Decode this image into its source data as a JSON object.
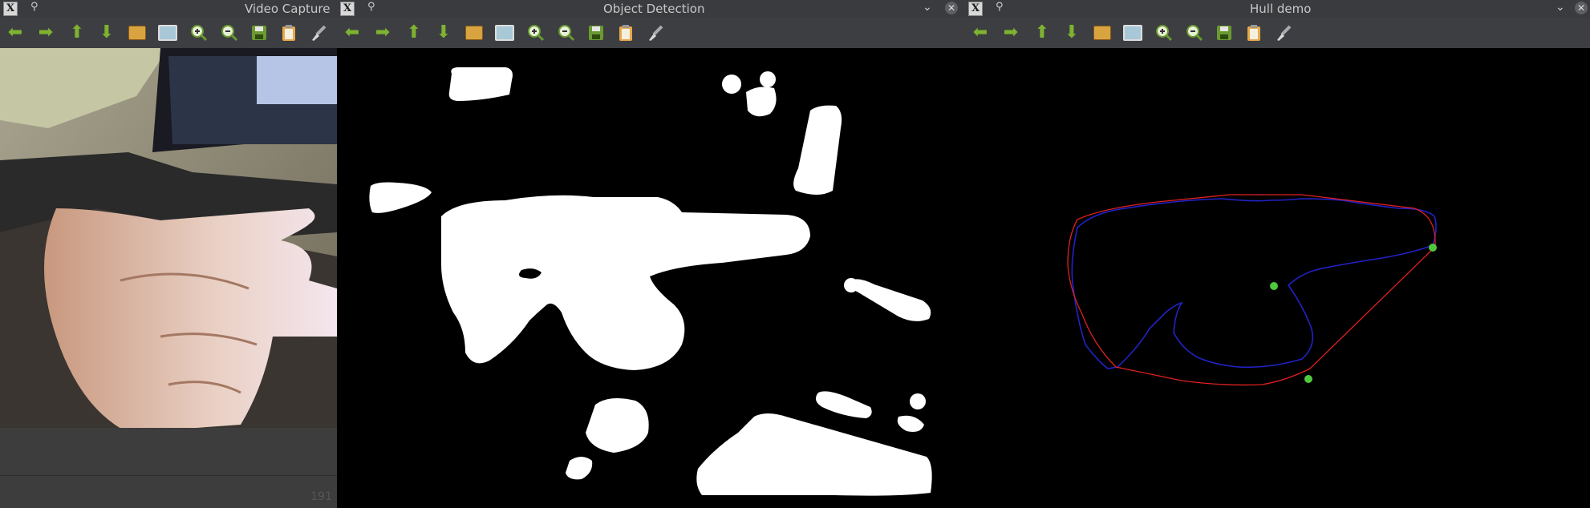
{
  "windows": {
    "video": {
      "title": "Video Capture",
      "status_value": "191"
    },
    "detect": {
      "title": "Object Detection"
    },
    "hull": {
      "title": "Hull demo"
    }
  },
  "icons": {
    "x_logo": "X",
    "pin": "⚲",
    "chevron": "⌄",
    "close": "✕",
    "back": "⬅",
    "forward": "➡",
    "up": "⬆",
    "down": "⬇"
  },
  "colors": {
    "toolbar_green": "#7fb230",
    "hull_line": "#e02020",
    "contour_line": "#2020c8",
    "defect_point": "#4ec83c",
    "mask_fg": "#ffffff",
    "mask_bg": "#000000"
  }
}
